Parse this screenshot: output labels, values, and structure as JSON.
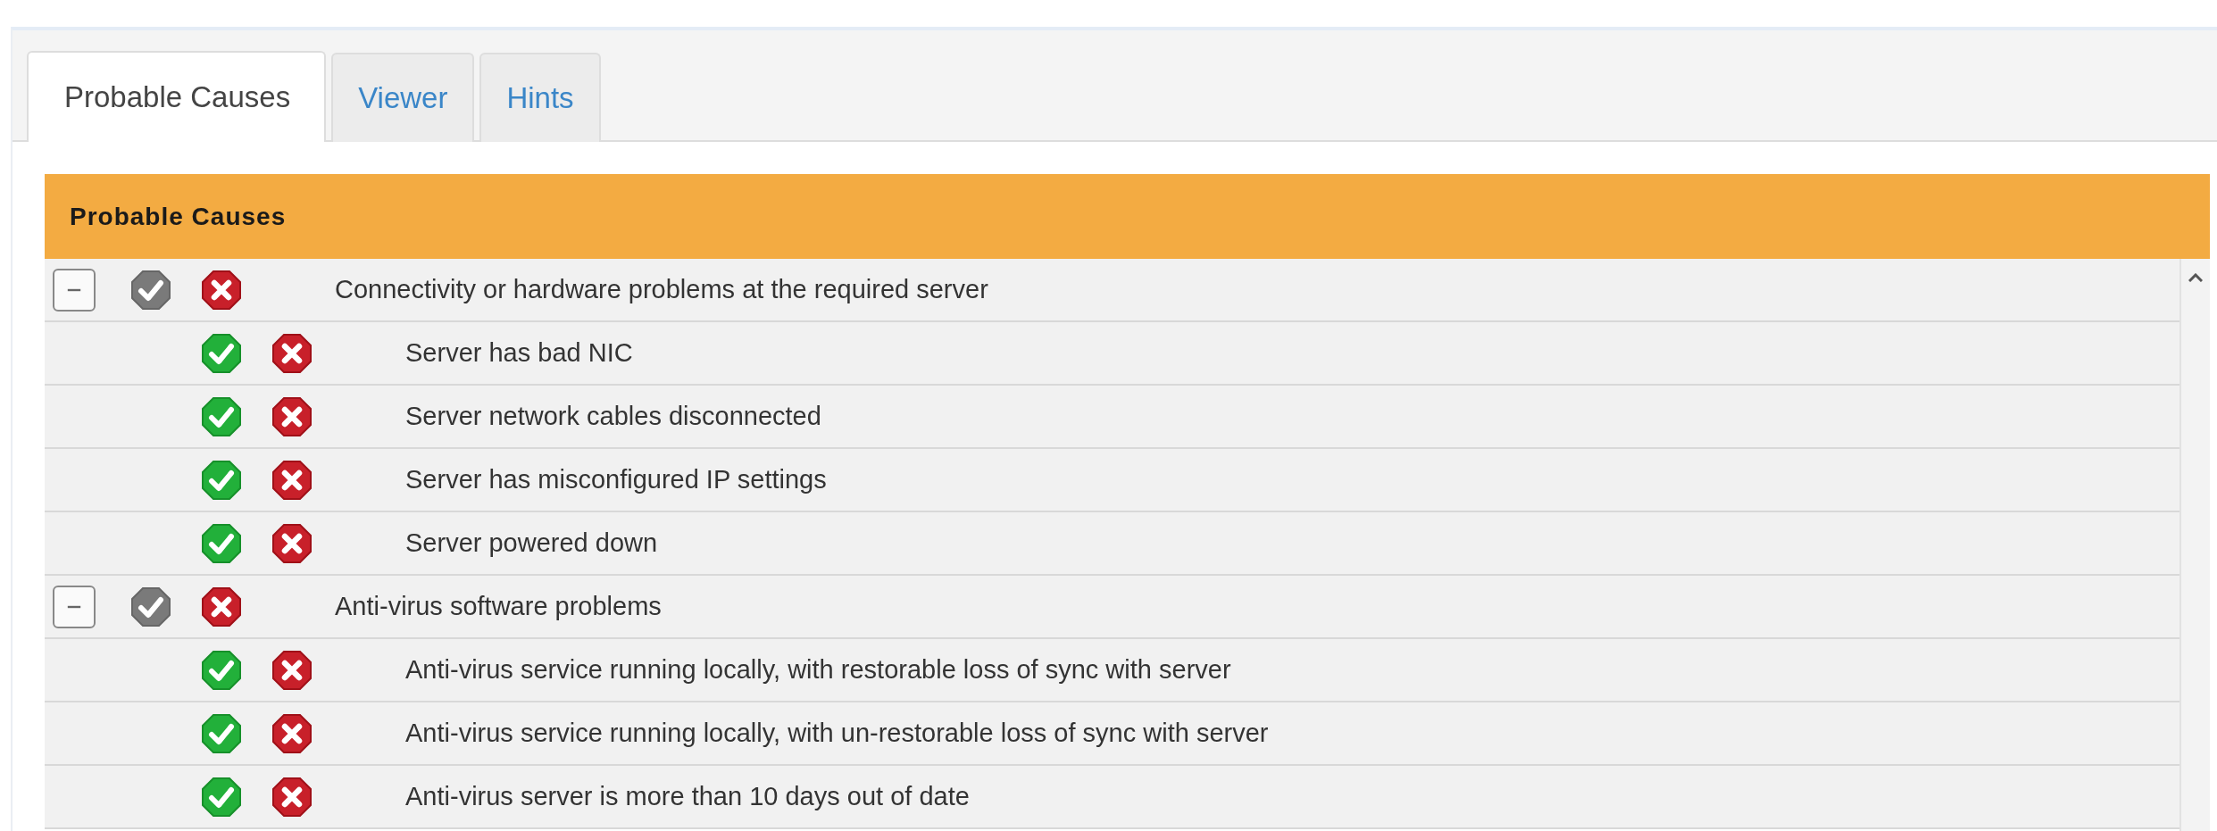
{
  "tabs": [
    {
      "label": "Probable Causes",
      "selected": true
    },
    {
      "label": "Viewer",
      "selected": false
    },
    {
      "label": "Hints",
      "selected": false
    }
  ],
  "panel": {
    "title": "Probable Causes"
  },
  "causes": [
    {
      "text": "Connectivity or hardware problems at the required server",
      "expanded": true,
      "children": [
        {
          "text": "Server has bad NIC"
        },
        {
          "text": "Server network cables disconnected"
        },
        {
          "text": "Server has misconfigured IP settings"
        },
        {
          "text": "Server powered down"
        }
      ]
    },
    {
      "text": "Anti-virus software problems",
      "expanded": true,
      "children": [
        {
          "text": "Anti-virus service running locally, with restorable loss of sync with server"
        },
        {
          "text": "Anti-virus service running locally, with un-restorable loss of sync with server"
        },
        {
          "text": "Anti-virus server is more than 10 days out of date"
        }
      ]
    }
  ]
}
